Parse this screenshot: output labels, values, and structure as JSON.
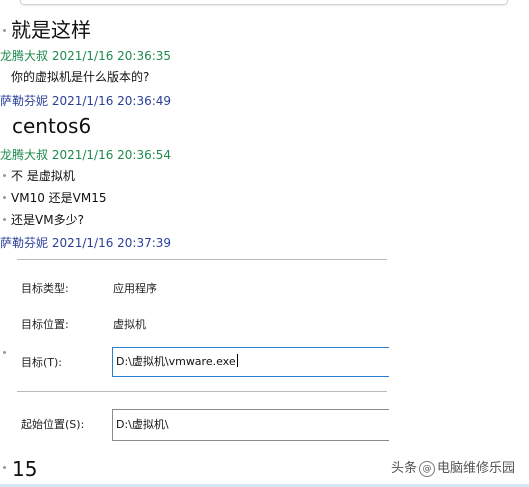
{
  "chat": {
    "line1": "就是这样",
    "sender1": "龙腾大叔 2021/1/16 20:36:35",
    "msg2": "你的虚拟机是什么版本的?",
    "sender2": "萨勒芬妮 2021/1/16 20:36:49",
    "msg3": "centos6",
    "sender3": "龙腾大叔 2021/1/16 20:36:54",
    "msg4a": "不 是虚拟机",
    "msg4b": "VM10  还是VM15",
    "msg4c": "还是VM多少?",
    "sender4": "萨勒芬妮 2021/1/16 20:37:39",
    "msg5": "15"
  },
  "dialog": {
    "target_type_label": "目标类型:",
    "target_type_value": "应用程序",
    "target_location_label": "目标位置:",
    "target_location_value": "虚拟机",
    "target_label": "目标(T):",
    "target_value": "D:\\虚拟机\\vmware.exe",
    "start_in_label": "起始位置(S):",
    "start_in_value": "D:\\虚拟机\\"
  },
  "watermark": {
    "prefix": "头条",
    "at": "@",
    "name": "电脑维修乐园"
  },
  "colors": {
    "sender_green": "#1e8a4d",
    "sender_blue": "#2a3f9a",
    "field_border": "#2b7cd3"
  }
}
